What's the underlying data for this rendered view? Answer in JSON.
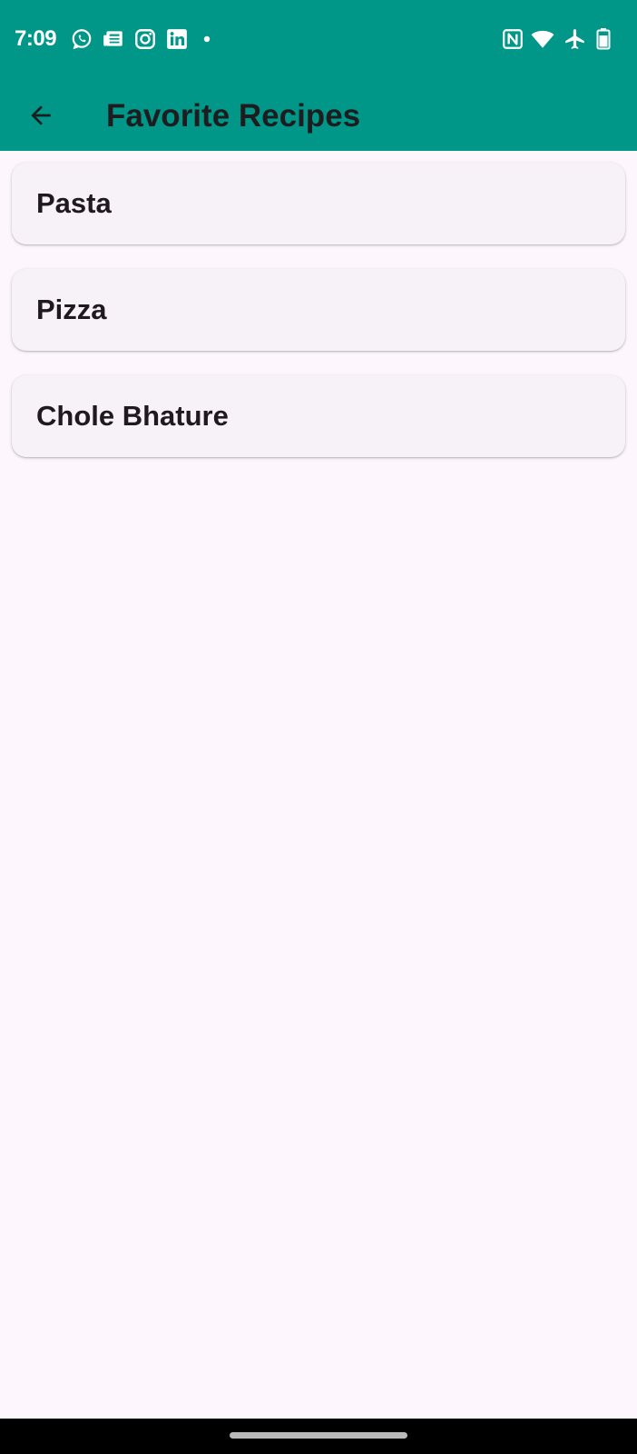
{
  "status_bar": {
    "time": "7:09",
    "background_color": "#009688",
    "left_icons": [
      "whatsapp-icon",
      "news-icon",
      "instagram-icon",
      "linkedin-icon",
      "notification-dot-icon"
    ],
    "right_icons": [
      "nfc-icon",
      "wifi-icon",
      "airplane-mode-icon",
      "battery-icon"
    ]
  },
  "app_bar": {
    "title": "Favorite Recipes",
    "back_icon": "arrow-back-icon",
    "background_color": "#009688"
  },
  "recipes": [
    {
      "name": "Pasta"
    },
    {
      "name": "Pizza"
    },
    {
      "name": "Chole Bhature"
    }
  ],
  "colors": {
    "page_background": "#fdf7fd",
    "card_background": "#f6f2f8",
    "title_text": "#1d1d20"
  }
}
